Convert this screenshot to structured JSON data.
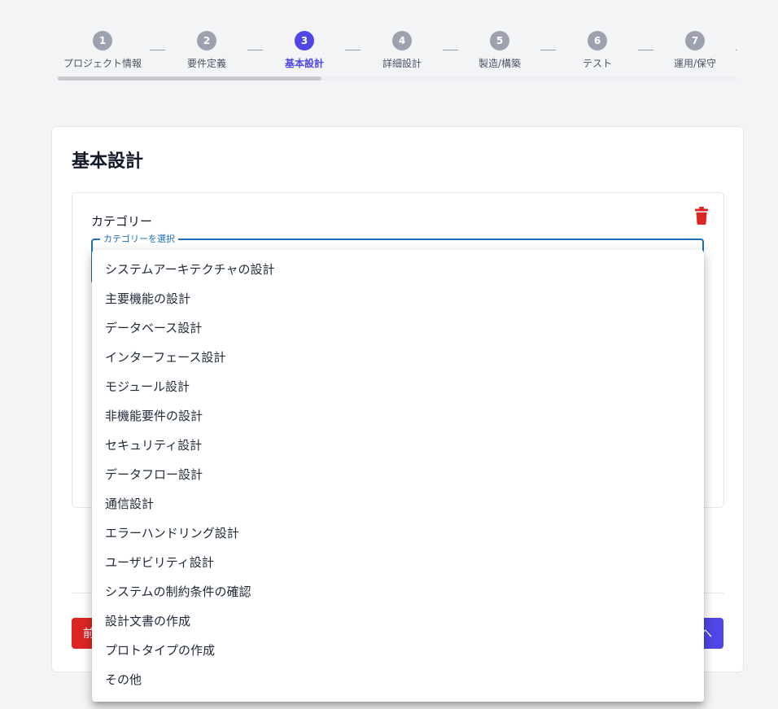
{
  "stepper": {
    "steps": [
      {
        "number": "1",
        "label": "プロジェクト情報"
      },
      {
        "number": "2",
        "label": "要件定義"
      },
      {
        "number": "3",
        "label": "基本設計"
      },
      {
        "number": "4",
        "label": "詳細設計"
      },
      {
        "number": "5",
        "label": "製造/構築"
      },
      {
        "number": "6",
        "label": "テスト"
      },
      {
        "number": "7",
        "label": "運用/保守"
      }
    ],
    "active_step": 3
  },
  "page": {
    "title": "基本設計"
  },
  "form": {
    "category_label": "カテゴリー",
    "select_legend": "カテゴリーを選択",
    "delete_icon": "trash-icon"
  },
  "footer": {
    "prev_label": "前",
    "next_label": "へ"
  },
  "dropdown": {
    "options": [
      "システムアーキテクチャの設計",
      "主要機能の設計",
      "データベース設計",
      "インターフェース設計",
      "モジュール設計",
      "非機能要件の設計",
      "セキュリティ設計",
      "データフロー設計",
      "通信設計",
      "エラーハンドリング設計",
      "ユーザビリティ設計",
      "システムの制約条件の確認",
      "設計文書の作成",
      "プロトタイプの作成",
      "その他"
    ]
  },
  "colors": {
    "accent": "#4f46e5",
    "danger": "#dc2626",
    "focus": "#1d6fb8",
    "inactive_step": "#9ca3af"
  }
}
